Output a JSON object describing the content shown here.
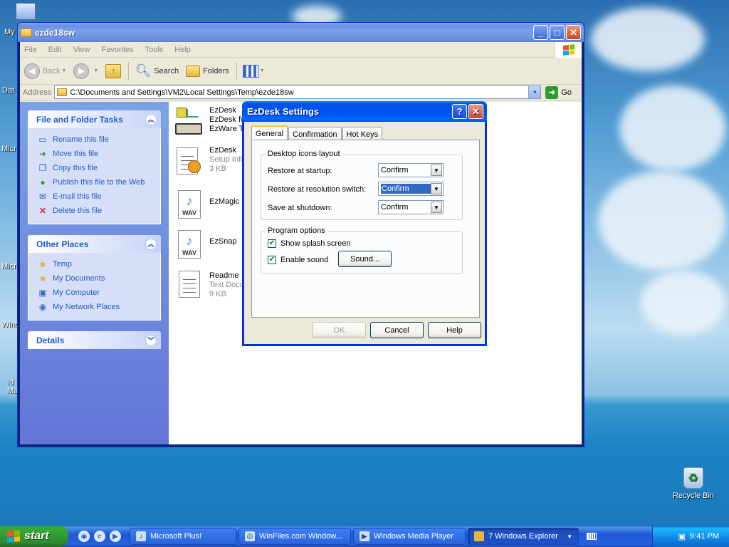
{
  "desktop": {
    "icons": [
      {
        "label": "My"
      },
      {
        "label": "Dat"
      },
      {
        "label": "Micr"
      },
      {
        "label": "Micr"
      },
      {
        "label": "Wind"
      },
      {
        "label": "Id Ma"
      }
    ],
    "recycle_bin": "Recycle Bin"
  },
  "explorer": {
    "title": "ezde18sw",
    "menu": [
      "File",
      "Edit",
      "View",
      "Favorites",
      "Tools",
      "Help"
    ],
    "toolbar": {
      "back": "Back",
      "search": "Search",
      "folders": "Folders"
    },
    "address_label": "Address",
    "address_value": "C:\\Documents and Settings\\VM2\\Local Settings\\Temp\\ezde18sw",
    "go_label": "Go",
    "panels": {
      "tasks": {
        "title": "File and Folder Tasks",
        "items": [
          "Rename this file",
          "Move this file",
          "Copy this file",
          "Publish this file to the Web",
          "E-mail this file",
          "Delete this file"
        ]
      },
      "places": {
        "title": "Other Places",
        "items": [
          "Temp",
          "My Documents",
          "My Computer",
          "My Network Places"
        ]
      },
      "details": {
        "title": "Details"
      }
    },
    "files": [
      {
        "name": "EzDesk",
        "line2": "EzDesk fo",
        "line3": "EzWare T"
      },
      {
        "name": "EzDesk",
        "line2": "Setup Info",
        "line3": "3 KB"
      },
      {
        "name": "EzMagic",
        "badge": "WAV"
      },
      {
        "name": "EzSnap",
        "badge": "WAV"
      },
      {
        "name": "Readme",
        "line2": "Text Docu",
        "line3": "9 KB"
      }
    ]
  },
  "dialog": {
    "title": "EzDesk Settings",
    "help_btn": "?",
    "close_btn": "✕",
    "tabs": [
      "General",
      "Confirmation",
      "Hot Keys"
    ],
    "group1": {
      "title": "Desktop icons layout",
      "rows": [
        {
          "label": "Restore at startup:",
          "value": "Confirm"
        },
        {
          "label": "Restore at resolution switch:",
          "value": "Confirm"
        },
        {
          "label": "Save at shutdown:",
          "value": "Confirm"
        }
      ]
    },
    "group2": {
      "title": "Program options",
      "splash": "Show splash screen",
      "sound": "Enable sound",
      "sound_btn": "Sound..."
    },
    "buttons": {
      "ok": "OK",
      "cancel": "Cancel",
      "help": "Help"
    }
  },
  "taskbar": {
    "start": "start",
    "tasks": [
      "Microsoft Plus!",
      "WinFiles.com Window...",
      "Windows Media Player",
      "7 Windows Explorer"
    ],
    "clock": "9:41 PM"
  }
}
